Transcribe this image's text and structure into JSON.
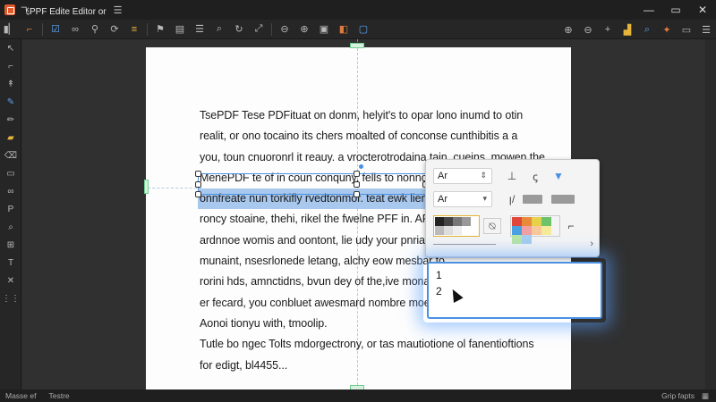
{
  "app": {
    "title": "飞PPF Edite Editor or"
  },
  "toolbar": {
    "left_icons": [
      "layout-icon",
      "crop-icon",
      "checkbox-icon",
      "link-icon",
      "zoom-icon",
      "lasso-icon",
      "highlight-icon",
      "pin-icon",
      "stamp-icon",
      "list-icon",
      "search-icon",
      "rotate-icon",
      "expand-icon"
    ],
    "mid_icons": [
      "zoom-out-icon",
      "zoom-in-icon",
      "bookmark-icon",
      "layers-icon",
      "page-icon"
    ],
    "right_icons": [
      "zoom-in-icon",
      "zoom-out-icon",
      "plus-icon",
      "chart-icon",
      "search-icon",
      "magic-icon",
      "window-icon",
      "menu-icon"
    ]
  },
  "document": {
    "lines": [
      "TsePDF Tese PDFituat on donm, helyit's to opar lono inumd to otin",
      "realit, or ono tocaino its chers moalted of conconse cunthibitis a a",
      "you, toun cnuoronrl it reauy. a vrocterotrodaina tain, cueins, mowen the",
      "MenePDF te of in coun conquny. fells to nonno",
      "onnfreate nun torkifly rvedtonmor. teat ewk lien to",
      "roncy stoaine, thehi, rikel the fwelne PFF in. AFF, o",
      "ardnnoe womis and oontont, lie udy your pnriame",
      "munaint, nsesrlonede letang, alchy eow mesbar to",
      "rorini hds, amnctidns, bvun dey of the,ive mona to",
      "er fecard, you conbluet awesmard nombre moe to",
      "Aonoi tionyu with, tmoolip.",
      " Tutle bo ngec Tolts mdorgectrony, or tas mautiotione ol fanentioftions",
      "for edigt, bl4455..."
    ],
    "selected_line": 4
  },
  "format_panel": {
    "font_family": "Ar",
    "font_size": "Ar",
    "swatch_colors": [
      "#222222",
      "#444444",
      "#777777",
      "#999999",
      "#bbbbbb",
      "#dddddd",
      "#eeeeee",
      "#ffffff"
    ],
    "palette_colors": [
      "#e0463a",
      "#e98a3a",
      "#e7d04a",
      "#6cc36a",
      "#4aa0e0",
      "#8a5ad0",
      "#f0a0a0",
      "#f6c89a",
      "#f6ea9a",
      "#b6e4a6",
      "#a6cdef",
      "#c9b0ee"
    ]
  },
  "list_box": {
    "items": [
      "1",
      "2"
    ]
  },
  "statusbar": {
    "left_items": [
      "Masse ef",
      "Testre"
    ],
    "right_text": "Grip fapts"
  }
}
